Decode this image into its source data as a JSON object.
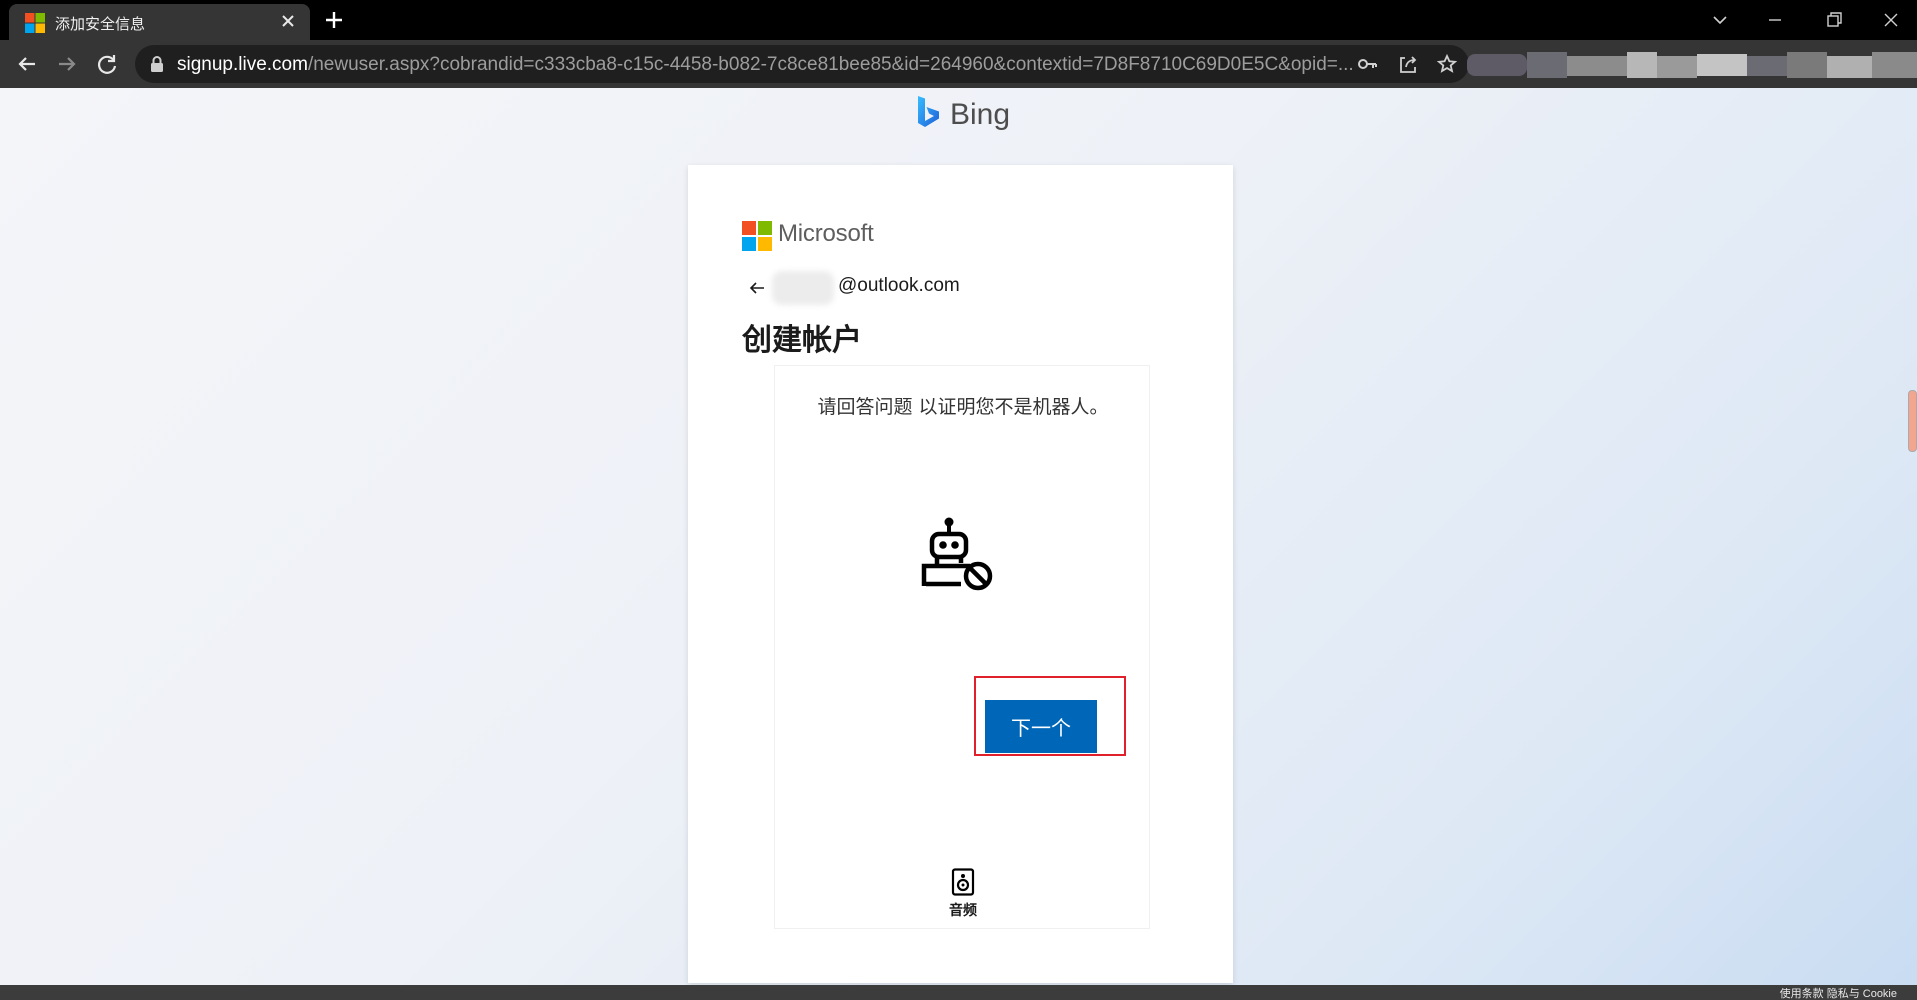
{
  "browser": {
    "tab_title": "添加安全信息",
    "url_host": "signup.live.com",
    "url_rest": "/newuser.aspx?cobrandid=c333cba8-c15c-4458-b082-7c8ce81bee85&id=264960&contextid=7D8F8710C69D0E5C&opid=..."
  },
  "page": {
    "brand": "Bing",
    "microsoft_word": "Microsoft",
    "email_suffix": "@outlook.com",
    "heading": "创建帐户",
    "prompt": "请回答问题 以证明您不是机器人。",
    "next_button": "下一个",
    "audio_label": "音频",
    "footer": "使用条款    隐私与 Cookie"
  },
  "colors": {
    "primary_button": "#0067b8",
    "highlight_border": "#e0202a"
  },
  "icons": [
    "microsoft-logo-icon",
    "close-icon",
    "plus-icon",
    "back-icon",
    "forward-icon",
    "reload-icon",
    "lock-icon",
    "key-icon",
    "share-icon",
    "star-icon",
    "bing-logo-icon",
    "arrow-left-icon",
    "robot-block-icon",
    "speaker-icon"
  ]
}
